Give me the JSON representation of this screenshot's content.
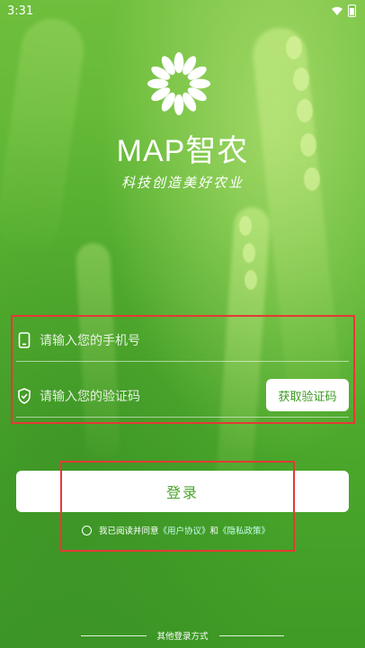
{
  "status_bar": {
    "time": "3:31"
  },
  "brand": {
    "name": "MAP智农",
    "slogan": "科技创造美好农业"
  },
  "form": {
    "phone_placeholder": "请输入您的手机号",
    "code_placeholder": "请输入您的验证码",
    "get_code_label": "获取验证码"
  },
  "login": {
    "button_label": "登录",
    "agreement": {
      "prefix": "我已阅读并同意",
      "user_agreement": "《用户协议》",
      "and": "和",
      "privacy_policy": "《隐私政策》",
      "checked": false
    }
  },
  "footer": {
    "other_login_label": "其他登录方式"
  },
  "colors": {
    "accent_green": "#4aa42a",
    "highlight_red": "#e53935",
    "link_color": "#c8ffef"
  },
  "icons": [
    "wifi-icon",
    "battery-icon",
    "daisy-logo-icon",
    "phone-icon",
    "shield-check-icon"
  ]
}
